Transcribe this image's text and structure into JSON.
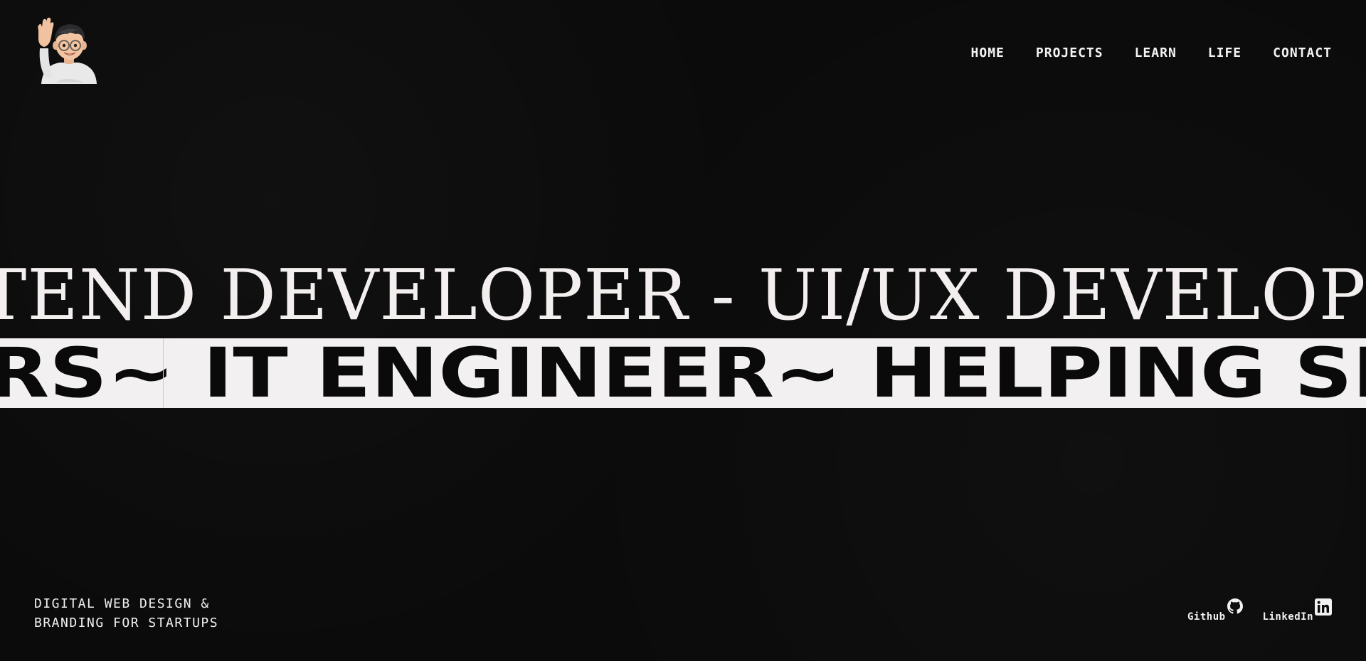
{
  "header": {
    "logo_icon": "memoji-waving-avatar-icon",
    "nav": [
      {
        "label": "HOME"
      },
      {
        "label": "PROJECTS"
      },
      {
        "label": "LEARN"
      },
      {
        "label": "LIFE"
      },
      {
        "label": "CONTACT"
      }
    ]
  },
  "hero": {
    "serif_line": "TEND DEVELOPER - UI/UX DEVELOPER",
    "sans_line": "RS~ IT ENGINEER~ HELPING SERIOUS"
  },
  "footer": {
    "tagline": [
      "DIGITAL WEB DESIGN &",
      "BRANDING FOR STARTUPS"
    ],
    "social": [
      {
        "label": "Github",
        "icon": "github-icon"
      },
      {
        "label": "LinkedIn",
        "icon": "linkedin-icon"
      }
    ]
  },
  "colors": {
    "background": "#0b0b0b",
    "text": "#f2f0f0",
    "band": "#f2f0f0",
    "band_text": "#0a0a0a"
  }
}
